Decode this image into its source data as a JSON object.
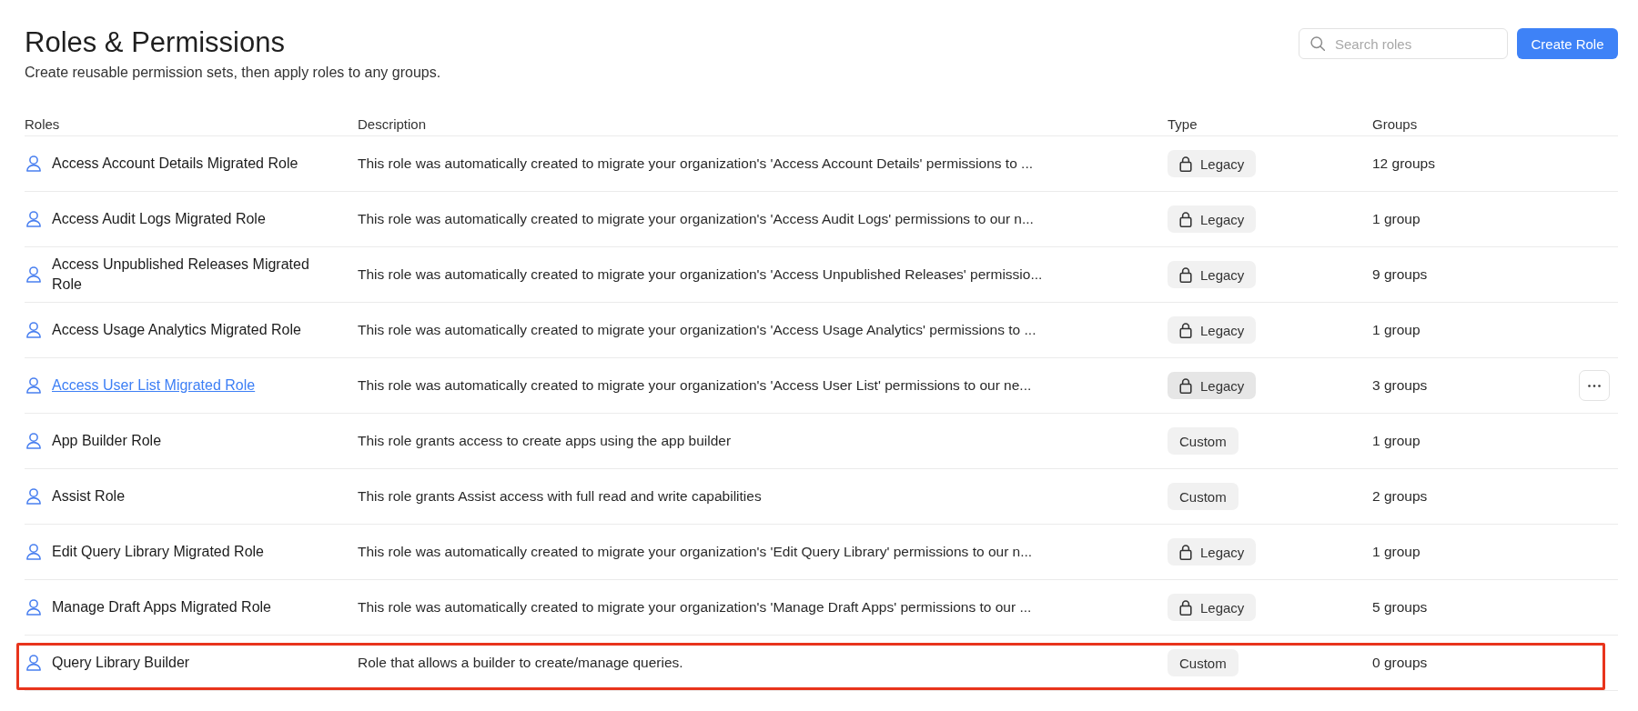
{
  "page": {
    "title": "Roles & Permissions",
    "subtitle": "Create reusable permission sets, then apply roles to any groups."
  },
  "search": {
    "placeholder": "Search roles"
  },
  "create_button": {
    "label": "Create Role"
  },
  "table": {
    "columns": [
      "Roles",
      "Description",
      "Type",
      "Groups"
    ],
    "rows": [
      {
        "name": "Access Account Details Migrated Role",
        "description": "This role was automatically created to migrate your organization's 'Access Account Details' permissions to ...",
        "type": {
          "kind": "legacy",
          "label": "Legacy"
        },
        "groups": "12 groups",
        "hovered": false,
        "highlighted": false
      },
      {
        "name": "Access Audit Logs Migrated Role",
        "description": "This role was automatically created to migrate your organization's 'Access Audit Logs' permissions to our n...",
        "type": {
          "kind": "legacy",
          "label": "Legacy"
        },
        "groups": "1 group",
        "hovered": false,
        "highlighted": false
      },
      {
        "name": "Access Unpublished Releases Migrated Role",
        "description": "This role was automatically created to migrate your organization's 'Access Unpublished Releases' permissio...",
        "type": {
          "kind": "legacy",
          "label": "Legacy"
        },
        "groups": "9 groups",
        "hovered": false,
        "highlighted": false
      },
      {
        "name": "Access Usage Analytics Migrated Role",
        "description": "This role was automatically created to migrate your organization's 'Access Usage Analytics' permissions to ...",
        "type": {
          "kind": "legacy",
          "label": "Legacy"
        },
        "groups": "1 group",
        "hovered": false,
        "highlighted": false
      },
      {
        "name": "Access User List Migrated Role",
        "description": "This role was automatically created to migrate your organization's 'Access User List' permissions to our ne...",
        "type": {
          "kind": "legacy",
          "label": "Legacy"
        },
        "groups": "3 groups",
        "hovered": true,
        "highlighted": false
      },
      {
        "name": "App Builder Role",
        "description": "This role grants access to create apps using the app builder",
        "type": {
          "kind": "custom",
          "label": "Custom"
        },
        "groups": "1 group",
        "hovered": false,
        "highlighted": false
      },
      {
        "name": "Assist Role",
        "description": "This role grants Assist access with full read and write capabilities",
        "type": {
          "kind": "custom",
          "label": "Custom"
        },
        "groups": "2 groups",
        "hovered": false,
        "highlighted": false
      },
      {
        "name": "Edit Query Library Migrated Role",
        "description": "This role was automatically created to migrate your organization's 'Edit Query Library' permissions to our n...",
        "type": {
          "kind": "legacy",
          "label": "Legacy"
        },
        "groups": "1 group",
        "hovered": false,
        "highlighted": false
      },
      {
        "name": "Manage Draft Apps Migrated Role",
        "description": "This role was automatically created to migrate your organization's 'Manage Draft Apps' permissions to our ...",
        "type": {
          "kind": "legacy",
          "label": "Legacy"
        },
        "groups": "5 groups",
        "hovered": false,
        "highlighted": false
      },
      {
        "name": "Query Library Builder",
        "description": "Role that allows a builder to create/manage queries.",
        "type": {
          "kind": "custom",
          "label": "Custom"
        },
        "groups": "0 groups",
        "hovered": false,
        "highlighted": true
      }
    ]
  }
}
